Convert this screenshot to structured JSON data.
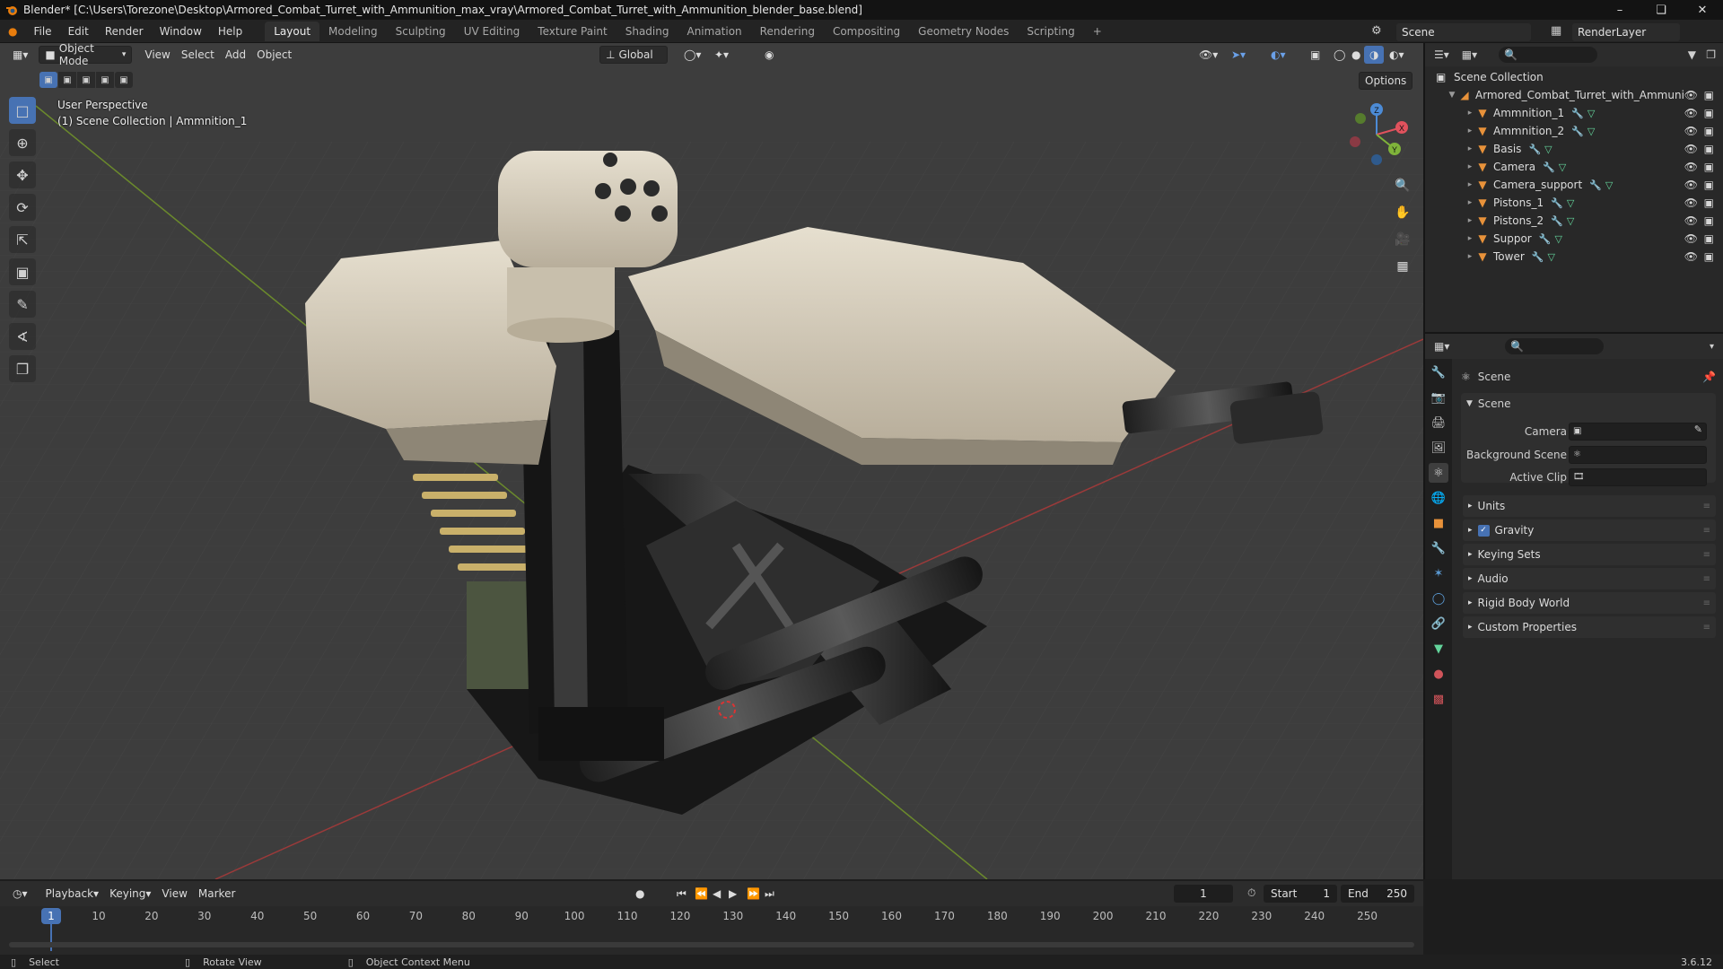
{
  "window": {
    "title": "Blender* [C:\\Users\\Torezone\\Desktop\\Armored_Combat_Turret_with_Ammunition_max_vray\\Armored_Combat_Turret_with_Ammunition_blender_base.blend]"
  },
  "menu": [
    "File",
    "Edit",
    "Render",
    "Window",
    "Help"
  ],
  "workspaces": [
    "Layout",
    "Modeling",
    "Sculpting",
    "UV Editing",
    "Texture Paint",
    "Shading",
    "Animation",
    "Rendering",
    "Compositing",
    "Geometry Nodes",
    "Scripting"
  ],
  "active_workspace": "Layout",
  "scene_field": "Scene",
  "renderlayer_field": "RenderLayer",
  "viewport": {
    "mode": "Object Mode",
    "menus": [
      "View",
      "Select",
      "Add",
      "Object"
    ],
    "transform_orientation": "Global",
    "options": "Options",
    "info_line1": "User Perspective",
    "info_line2": "(1) Scene Collection | Ammnition_1",
    "gizmo": {
      "x": "X",
      "y": "Y",
      "z": "Z"
    }
  },
  "outliner": {
    "root": "Scene Collection",
    "collection": "Armored_Combat_Turret_with_Ammuni",
    "objects": [
      "Ammnition_1",
      "Ammnition_2",
      "Basis",
      "Camera",
      "Camera_support",
      "Pistons_1",
      "Pistons_2",
      "Suppor",
      "Tower"
    ]
  },
  "properties": {
    "context": "Scene",
    "panel_title": "Scene",
    "camera_label": "Camera",
    "background_label": "Background Scene",
    "clip_label": "Active Clip",
    "sections": [
      "Units",
      "Gravity",
      "Keying Sets",
      "Audio",
      "Rigid Body World",
      "Custom Properties"
    ],
    "gravity_checked": true
  },
  "timeline": {
    "menus": [
      "Playback",
      "Keying",
      "View",
      "Marker"
    ],
    "current_frame": "1",
    "start_label": "Start",
    "start": "1",
    "end_label": "End",
    "end": "250",
    "ticks": [
      "1",
      "10",
      "20",
      "30",
      "40",
      "50",
      "60",
      "70",
      "80",
      "90",
      "100",
      "110",
      "120",
      "130",
      "140",
      "150",
      "160",
      "170",
      "180",
      "190",
      "200",
      "210",
      "220",
      "230",
      "240",
      "250"
    ]
  },
  "status": {
    "select": "Select",
    "rotate": "Rotate View",
    "context_menu": "Object Context Menu",
    "version": "3.6.12"
  },
  "colors": {
    "accent": "#4772b3",
    "object_icon": "#e8923a",
    "turret_body": "#d8d0bf",
    "viewport_bg": "#3d3d3d"
  }
}
